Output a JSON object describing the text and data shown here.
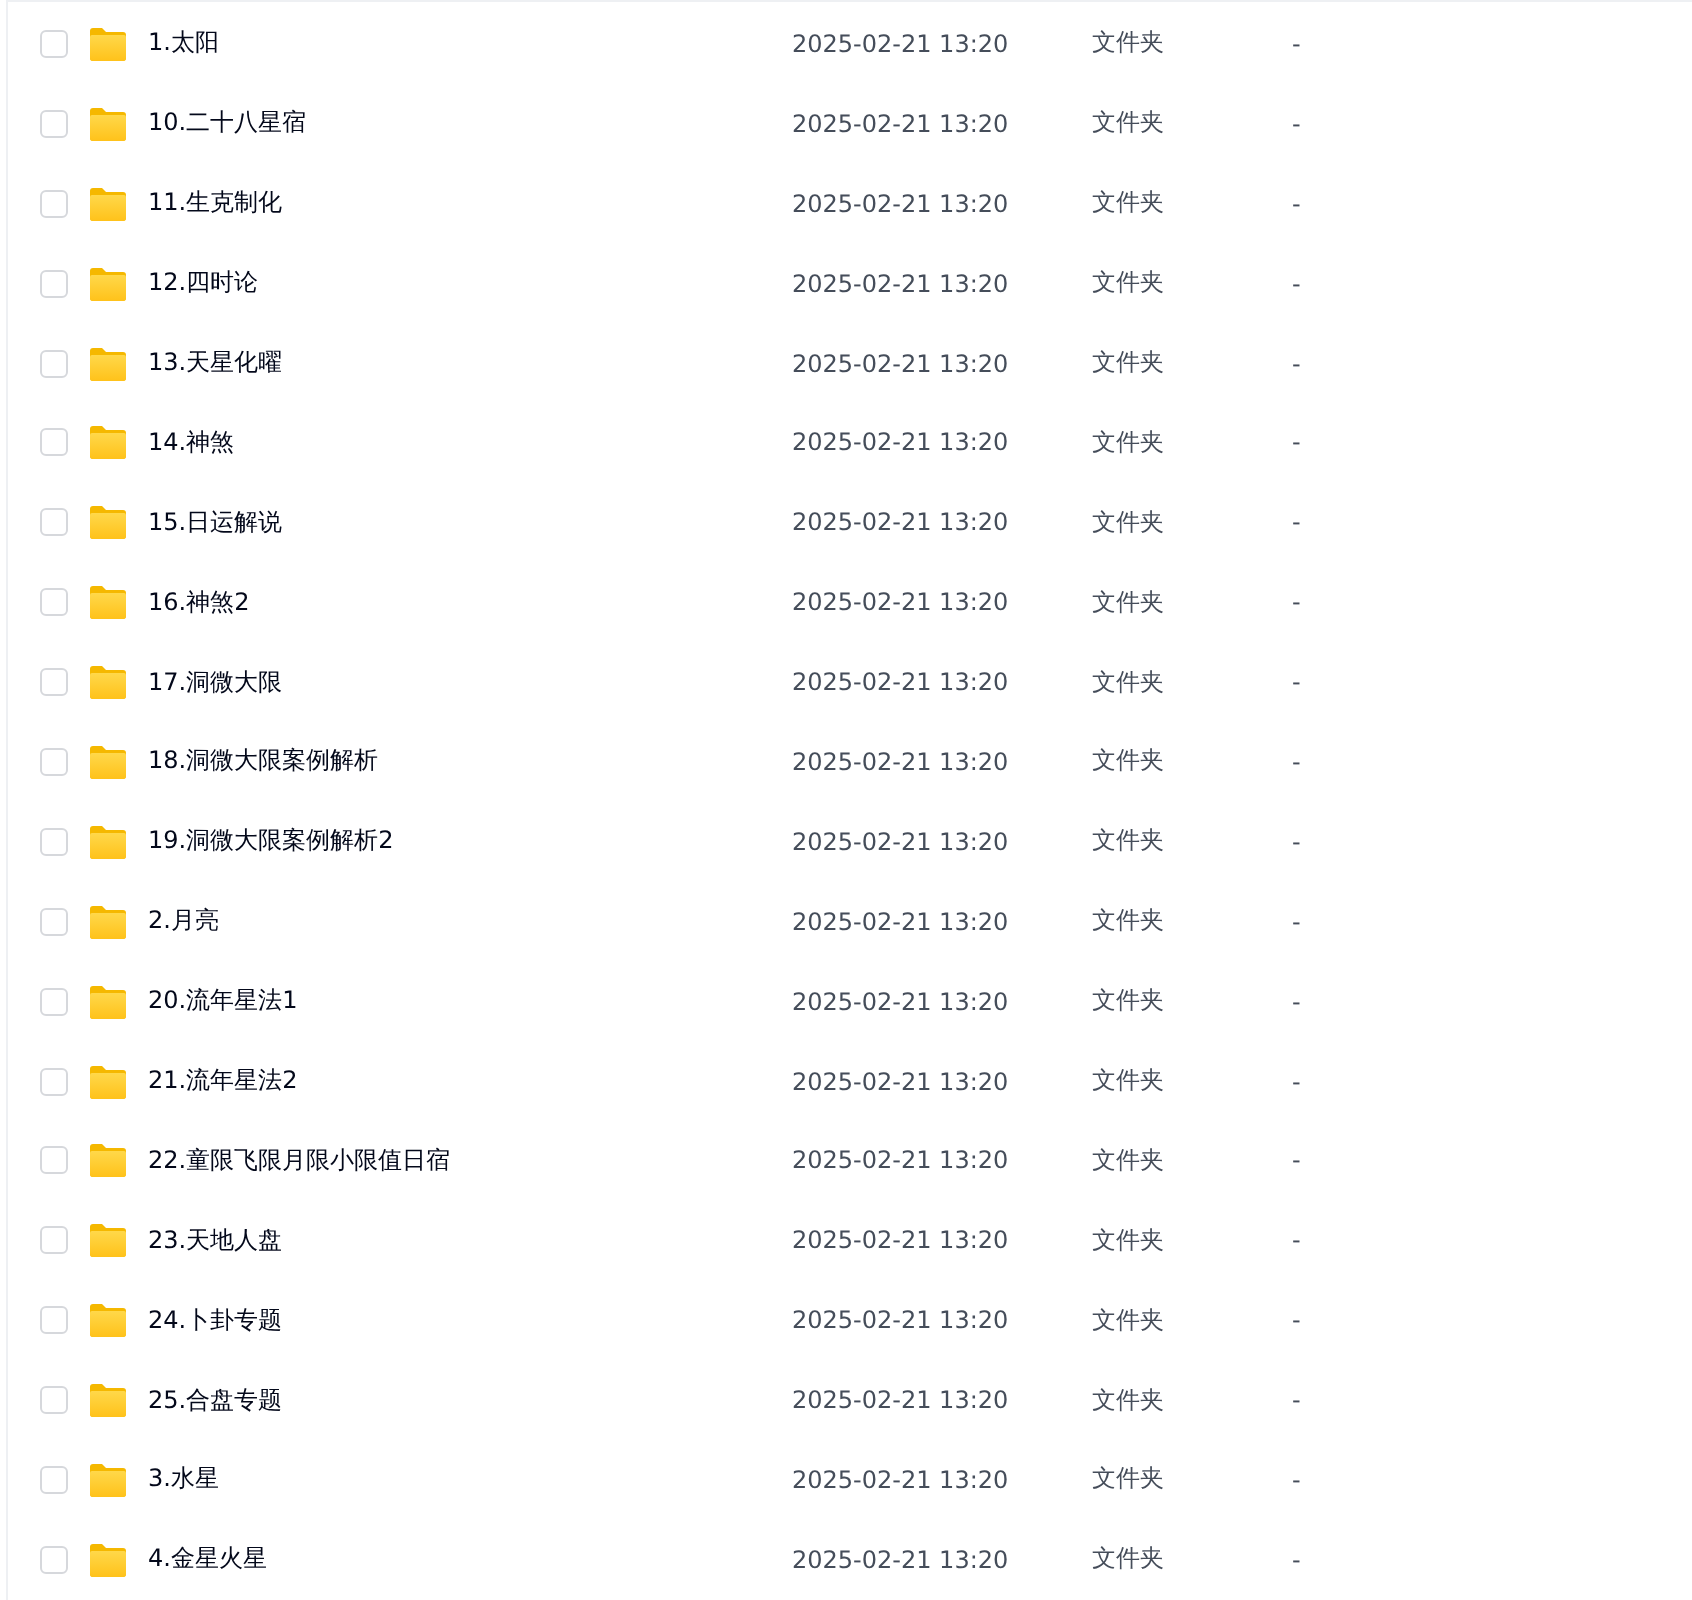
{
  "files": [
    {
      "name": "1.太阳",
      "modified": "2025-02-21 13:20",
      "type": "文件夹",
      "size": "-",
      "checked": false
    },
    {
      "name": "10.二十八星宿",
      "modified": "2025-02-21 13:20",
      "type": "文件夹",
      "size": "-",
      "checked": false
    },
    {
      "name": "11.生克制化",
      "modified": "2025-02-21 13:20",
      "type": "文件夹",
      "size": "-",
      "checked": false
    },
    {
      "name": "12.四时论",
      "modified": "2025-02-21 13:20",
      "type": "文件夹",
      "size": "-",
      "checked": false
    },
    {
      "name": "13.天星化曜",
      "modified": "2025-02-21 13:20",
      "type": "文件夹",
      "size": "-",
      "checked": false
    },
    {
      "name": "14.神煞",
      "modified": "2025-02-21 13:20",
      "type": "文件夹",
      "size": "-",
      "checked": false
    },
    {
      "name": "15.日运解说",
      "modified": "2025-02-21 13:20",
      "type": "文件夹",
      "size": "-",
      "checked": false
    },
    {
      "name": "16.神煞2",
      "modified": "2025-02-21 13:20",
      "type": "文件夹",
      "size": "-",
      "checked": false
    },
    {
      "name": "17.洞微大限",
      "modified": "2025-02-21 13:20",
      "type": "文件夹",
      "size": "-",
      "checked": false
    },
    {
      "name": "18.洞微大限案例解析",
      "modified": "2025-02-21 13:20",
      "type": "文件夹",
      "size": "-",
      "checked": false
    },
    {
      "name": "19.洞微大限案例解析2",
      "modified": "2025-02-21 13:20",
      "type": "文件夹",
      "size": "-",
      "checked": false
    },
    {
      "name": "2.月亮",
      "modified": "2025-02-21 13:20",
      "type": "文件夹",
      "size": "-",
      "checked": false
    },
    {
      "name": "20.流年星法1",
      "modified": "2025-02-21 13:20",
      "type": "文件夹",
      "size": "-",
      "checked": false
    },
    {
      "name": "21.流年星法2",
      "modified": "2025-02-21 13:20",
      "type": "文件夹",
      "size": "-",
      "checked": false
    },
    {
      "name": "22.童限飞限月限小限值日宿",
      "modified": "2025-02-21 13:20",
      "type": "文件夹",
      "size": "-",
      "checked": false
    },
    {
      "name": "23.天地人盘",
      "modified": "2025-02-21 13:20",
      "type": "文件夹",
      "size": "-",
      "checked": false
    },
    {
      "name": "24.卜卦专题",
      "modified": "2025-02-21 13:20",
      "type": "文件夹",
      "size": "-",
      "checked": false
    },
    {
      "name": "25.合盘专题",
      "modified": "2025-02-21 13:20",
      "type": "文件夹",
      "size": "-",
      "checked": false
    },
    {
      "name": "3.水星",
      "modified": "2025-02-21 13:20",
      "type": "文件夹",
      "size": "-",
      "checked": false
    },
    {
      "name": "4.金星火星",
      "modified": "2025-02-21 13:20",
      "type": "文件夹",
      "size": "-",
      "checked": false
    }
  ]
}
